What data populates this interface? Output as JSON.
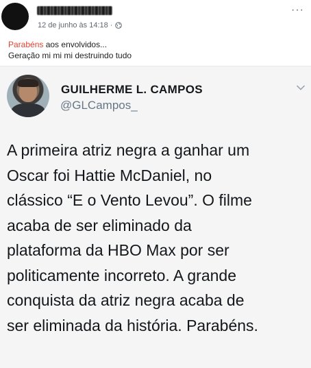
{
  "post": {
    "author_name": "",
    "timestamp": "12 de junho às 14:18",
    "separator": "·",
    "privacy_icon": "globe-icon",
    "more_icon": "···",
    "text_highlight": "Parabéns",
    "text_line1_rest": " aos envolvidos...",
    "text_line2": "Geração mi mi mi destruindo tudo"
  },
  "tweet": {
    "name": "GUILHERME L. CAMPOS",
    "handle": "@GLCampos_",
    "body": "A primeira atriz negra a ganhar um\nOscar foi Hattie McDaniel, no\nclássico “E o Vento Levou”. O filme\nacaba de ser eliminado da\nplataforma da HBO Max por ser\npoliticamente incorreto. A grande\nconquista da atriz negra acaba de\nser eliminada da história. Parabéns."
  },
  "colors": {
    "highlight": "#e4412e",
    "meta_text": "#606770",
    "tweet_background": "#f5f5f6",
    "handle": "#657786"
  }
}
